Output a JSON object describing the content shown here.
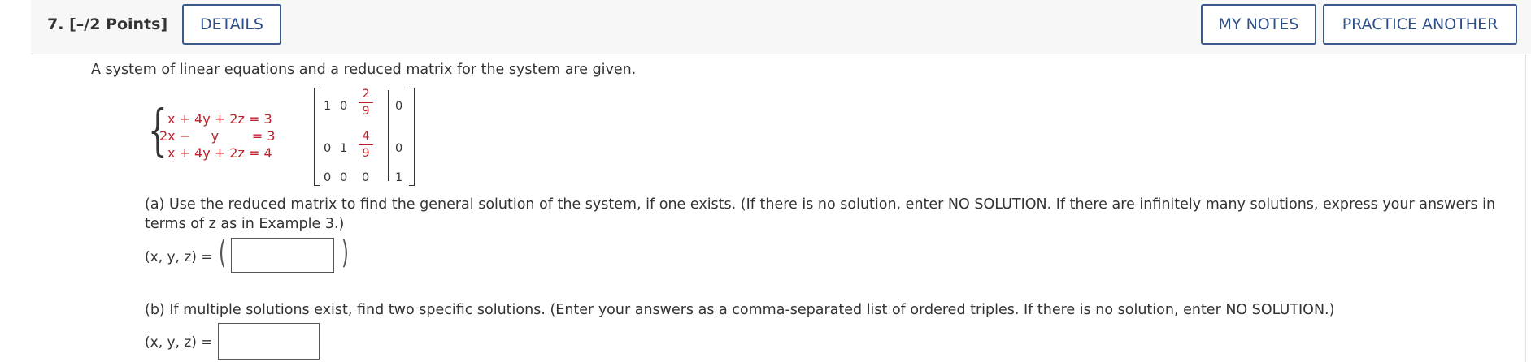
{
  "question": {
    "number": "7.",
    "points": "[–/2 Points]",
    "details_label": "DETAILS",
    "my_notes_label": "MY NOTES",
    "practice_label": "PRACTICE ANOTHER"
  },
  "intro": "A system of linear equations and a reduced matrix for the system are given.",
  "system": {
    "eq1": {
      "lhs": "x + 4y + 2z = ",
      "rhs": "3"
    },
    "eq2": {
      "lhs": "2x −     y        = ",
      "rhs": "3"
    },
    "eq3": {
      "lhs": "x + 4y + 2z = ",
      "rhs": "4"
    }
  },
  "matrix": {
    "row1": {
      "a": "1",
      "b": "0",
      "c_num": "2",
      "c_den": "9",
      "d": "0"
    },
    "row2": {
      "a": "0",
      "b": "1",
      "c_num": "4",
      "c_den": "9",
      "d": "0"
    },
    "row3": {
      "a": "0",
      "b": "0",
      "c": "0",
      "d": "1"
    }
  },
  "part_a": {
    "text": "(a) Use the reduced matrix to find the general solution of the system, if one exists. (If there is no solution, enter NO SOLUTION. If there are infinitely many solutions, express your answers in terms of z as in Example 3.)",
    "label": "(x, y, z) =",
    "answer_value": ""
  },
  "part_b": {
    "text": "(b) If multiple solutions exist, find two specific solutions. (Enter your answers as a comma-separated list of ordered triples. If there is no solution, enter NO SOLUTION.)",
    "label": "(x, y, z) =",
    "answer_value": ""
  },
  "colors": {
    "accent_blue": "#2c4f87",
    "math_red": "#c0202a"
  }
}
